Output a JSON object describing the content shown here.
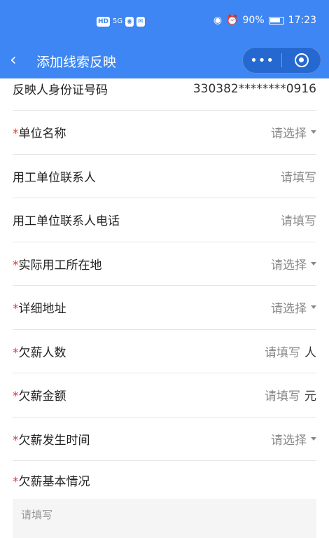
{
  "status_bar": {
    "hd": "HD",
    "network": "5G",
    "battery": "90%",
    "time": "17:23"
  },
  "nav": {
    "title": "添加线索反映",
    "more": "•••"
  },
  "form": {
    "id_number": {
      "label": "反映人身份证号码",
      "value": "330382********0916"
    },
    "rows": [
      {
        "required": "*",
        "label": "单位名称",
        "value": "请选择",
        "type": "select"
      },
      {
        "required": "",
        "label": "用工单位联系人",
        "value": "请填写",
        "type": "input"
      },
      {
        "required": "",
        "label": "用工单位联系人电话",
        "value": "请填写",
        "type": "input"
      },
      {
        "required": "*",
        "label": "实际用工所在地",
        "value": "请选择",
        "type": "select"
      },
      {
        "required": "*",
        "label": "详细地址",
        "value": "请选择",
        "type": "select"
      },
      {
        "required": "*",
        "label": "欠薪人数",
        "value": "请填写",
        "unit": "人",
        "type": "input"
      },
      {
        "required": "*",
        "label": "欠薪金额",
        "value": "请填写",
        "unit": "元",
        "type": "input"
      },
      {
        "required": "*",
        "label": "欠薪发生时间",
        "value": "请选择",
        "type": "select"
      }
    ],
    "description": {
      "required": "*",
      "label": "欠薪基本情况",
      "placeholder": "请填写"
    }
  }
}
